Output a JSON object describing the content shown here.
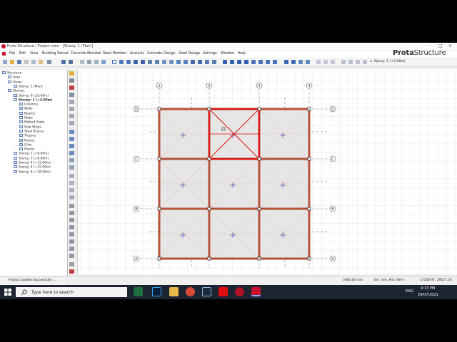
{
  "window": {
    "title": "Proto Structure / Project trein - [Storey: 1 (Plan)]",
    "minimize": "–",
    "maximize": "□",
    "close": "×"
  },
  "menu": [
    "File",
    "Edit",
    "View",
    "Building Setout",
    "Concrete Member",
    "Steel Member",
    "Analysis",
    "Concrete Design",
    "Steel Design",
    "Settings",
    "Window",
    "Help"
  ],
  "brand": {
    "bold": "Prota",
    "normal": "Structure"
  },
  "toolbar": {
    "storey_select": "o. Storey: 1 (+3.00m)"
  },
  "tree": [
    {
      "label": "Structure",
      "depth": 0,
      "bold": false
    },
    {
      "label": "Axes",
      "depth": 1,
      "bold": false
    },
    {
      "label": "Views",
      "depth": 1,
      "bold": false
    },
    {
      "label": "Storey: 1 (Plan)",
      "depth": 2,
      "bold": false
    },
    {
      "label": "Storeys",
      "depth": 1,
      "bold": false
    },
    {
      "label": "Storey: 0 (±0.00m)",
      "depth": 2,
      "bold": false
    },
    {
      "label": "Storey: 1 (+3.00m)",
      "depth": 2,
      "bold": true
    },
    {
      "label": "Columns",
      "depth": 3,
      "bold": false
    },
    {
      "label": "Walls",
      "depth": 3,
      "bold": false
    },
    {
      "label": "Beams",
      "depth": 3,
      "bold": false
    },
    {
      "label": "Slabs",
      "depth": 3,
      "bold": false
    },
    {
      "label": "Ribbed Slabs",
      "depth": 3,
      "bold": false
    },
    {
      "label": "Slab Strips",
      "depth": 3,
      "bold": false
    },
    {
      "label": "Steel Braces",
      "depth": 3,
      "bold": false
    },
    {
      "label": "Trusses",
      "depth": 3,
      "bold": false
    },
    {
      "label": "Purlins",
      "depth": 3,
      "bold": false
    },
    {
      "label": "Girts",
      "depth": 3,
      "bold": false
    },
    {
      "label": "Planes",
      "depth": 3,
      "bold": false
    },
    {
      "label": "Storey: 2 (+6.00m)",
      "depth": 2,
      "bold": false
    },
    {
      "label": "Storey: 3 (+9.00m)",
      "depth": 2,
      "bold": false
    },
    {
      "label": "Storey: 4 (+12.00m)",
      "depth": 2,
      "bold": false
    },
    {
      "label": "Storey: 5 (+15.00m)",
      "depth": 2,
      "bold": false
    },
    {
      "label": "Storey: 6 (+18.00m)",
      "depth": 2,
      "bold": false
    }
  ],
  "plan": {
    "axes_x": [
      "1",
      "2",
      "3",
      "4"
    ],
    "axes_y": [
      "D",
      "C",
      "B",
      "A"
    ]
  },
  "status": {
    "message": "Project Loaded Successfully ...",
    "grid": "3000.00 mm",
    "units": "GE: mm, Ant: kN-m",
    "coords": "17358.97, 29527.20"
  },
  "taskbar": {
    "search": "Type here to search",
    "lang": "ENG",
    "time": "9:13 PM",
    "date": "29/07/2021"
  },
  "colors": {
    "beam": "#b5523b",
    "selected": "#e01010",
    "slab": "#e6e6e6",
    "axis": "#555555"
  }
}
